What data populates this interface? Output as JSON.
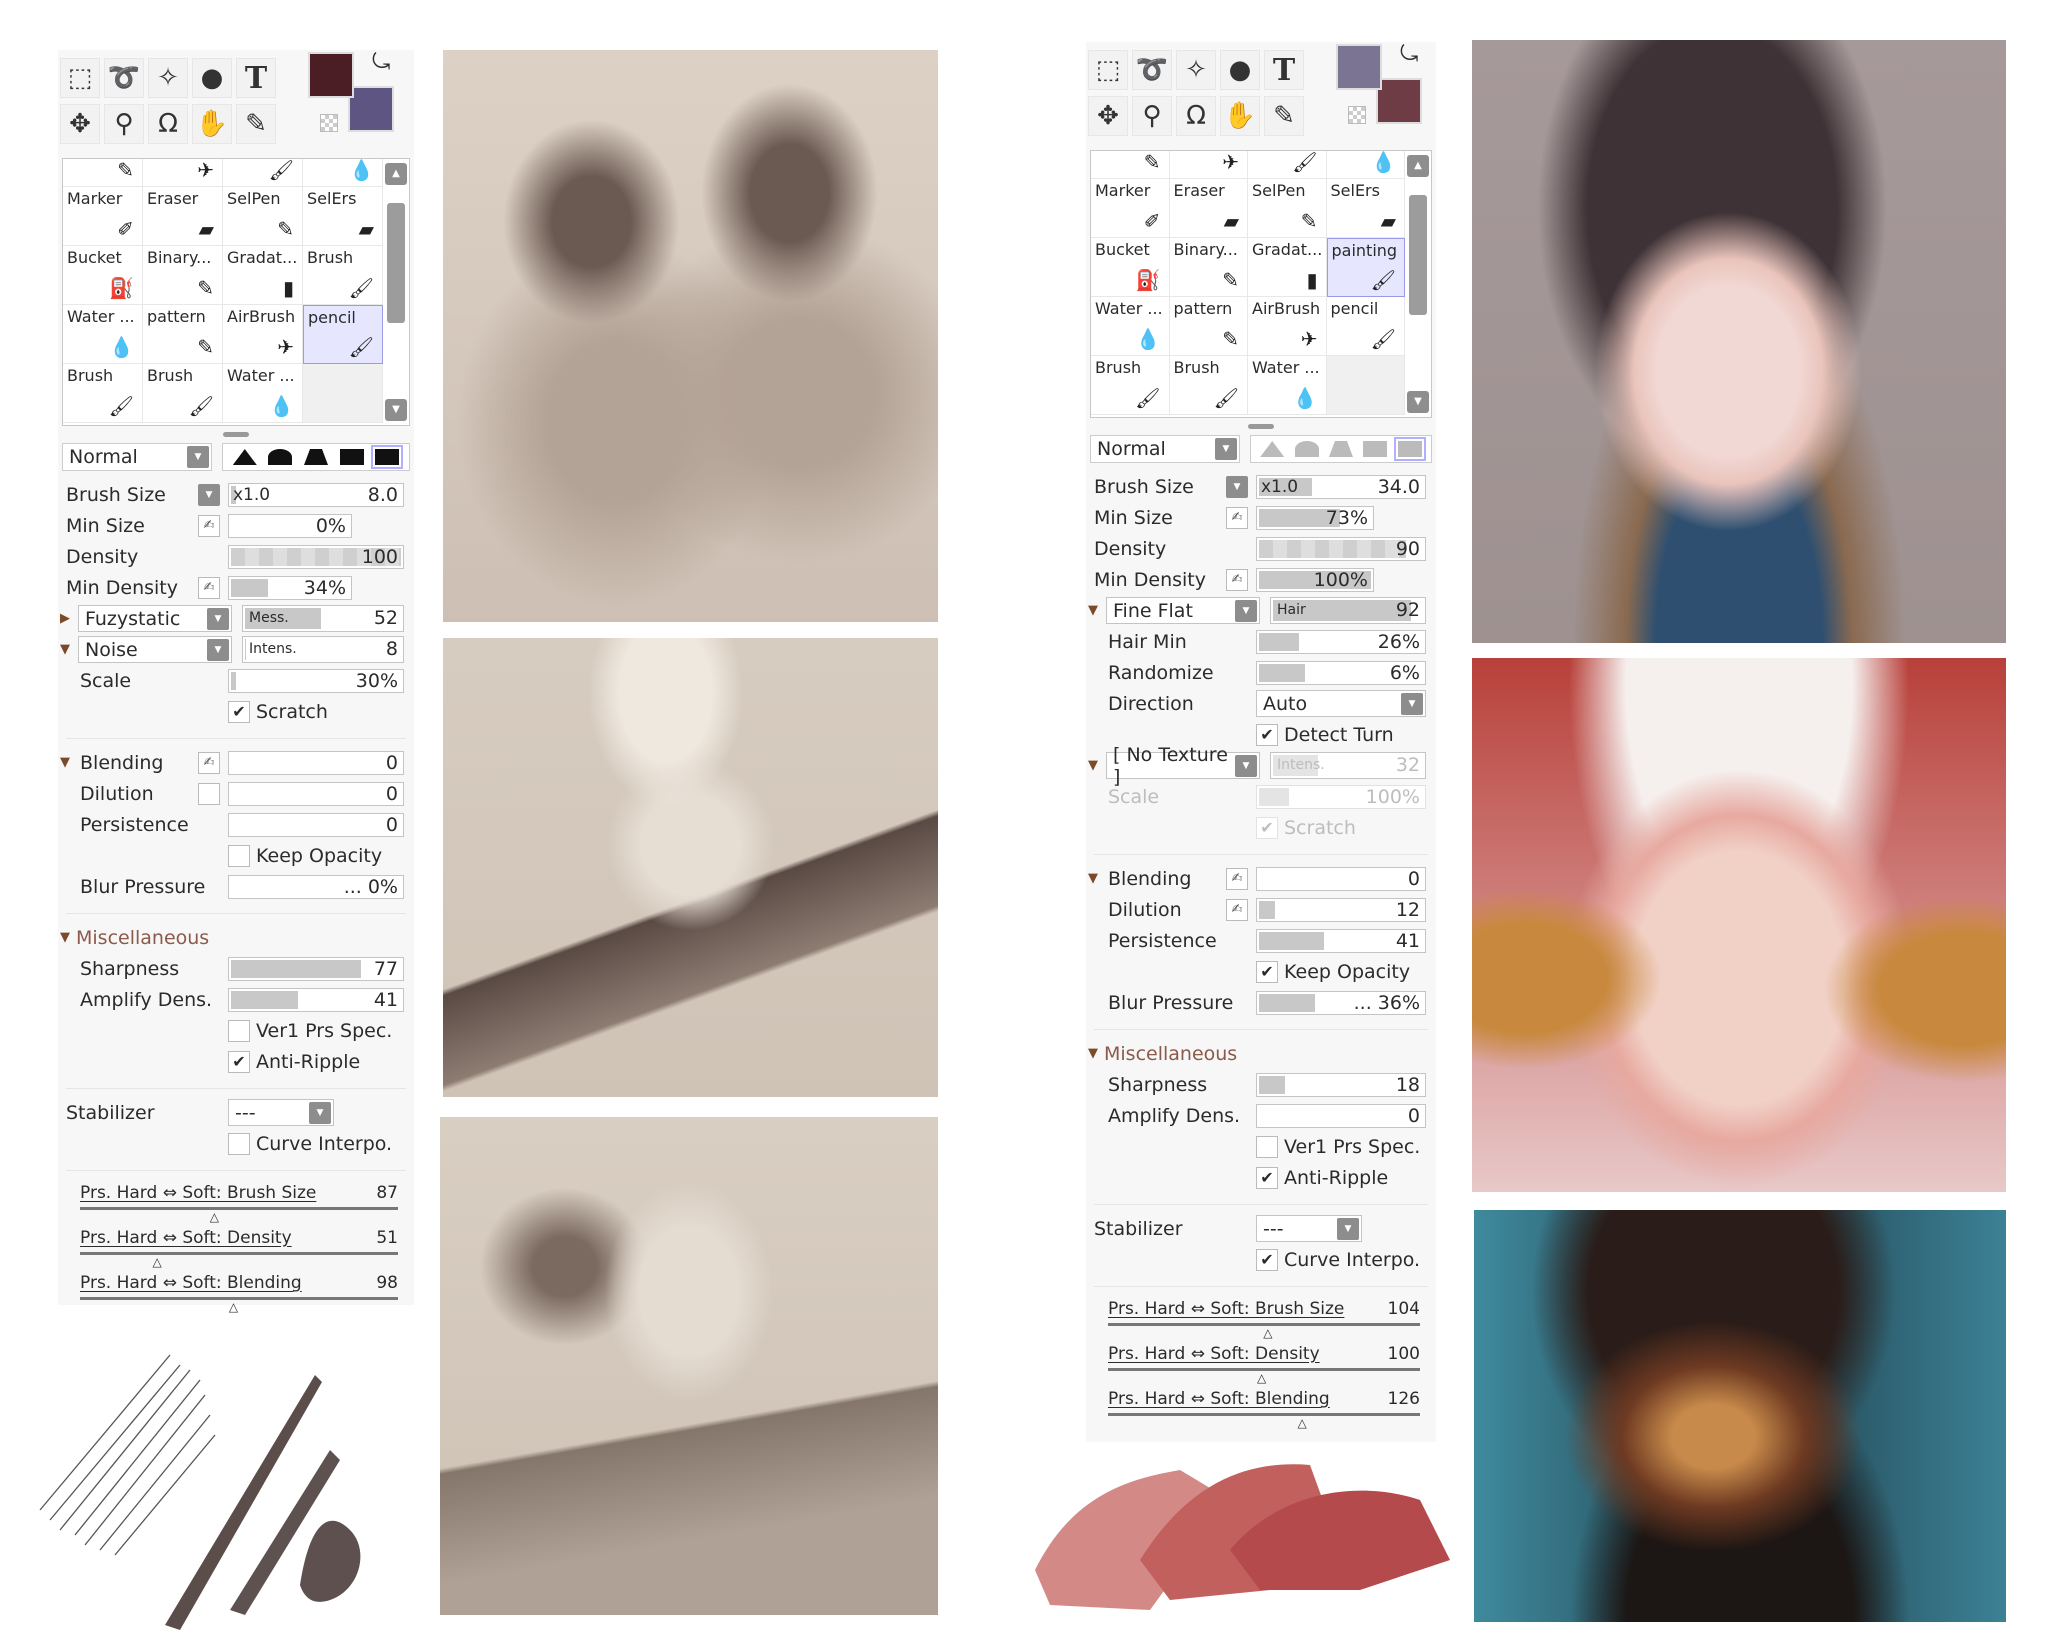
{
  "left_panel": {
    "colors": {
      "primary": "#4a1e24",
      "secondary": "#5f5582"
    },
    "tools": [
      "rect-select",
      "lasso",
      "magic-wand",
      "shapes",
      "text",
      "move",
      "zoom",
      "rotate",
      "hand",
      "eyedropper"
    ],
    "text_tool_label": "T",
    "brush_grid": [
      {
        "label": "",
        "icon": "pencil-icon"
      },
      {
        "label": "",
        "icon": "airbrush-icon"
      },
      {
        "label": "",
        "icon": "brush-icon"
      },
      {
        "label": "",
        "icon": "water-brush-icon"
      },
      {
        "label": "Marker",
        "icon": "marker-icon"
      },
      {
        "label": "Eraser",
        "icon": "eraser-icon"
      },
      {
        "label": "SelPen",
        "icon": "selpen-icon"
      },
      {
        "label": "SelErs",
        "icon": "selers-icon"
      },
      {
        "label": "Bucket",
        "icon": "bucket-icon"
      },
      {
        "label": "Binary...",
        "icon": "binary-pen-icon"
      },
      {
        "label": "Gradat...",
        "icon": "gradation-icon"
      },
      {
        "label": "Brush",
        "icon": "brush-icon"
      },
      {
        "label": "Water ...",
        "icon": "water-brush-icon"
      },
      {
        "label": "pattern",
        "icon": "pencil-icon"
      },
      {
        "label": "AirBrush",
        "icon": "airbrush-icon"
      },
      {
        "label": "pencil",
        "icon": "brush-icon",
        "selected": true
      },
      {
        "label": "Brush",
        "icon": "brush-icon"
      },
      {
        "label": "Brush",
        "icon": "brush-icon"
      },
      {
        "label": "Water ...",
        "icon": "water-brush-icon"
      },
      {
        "label": "",
        "empty": true
      }
    ],
    "blend_mode": "Normal",
    "brush_shape_selected": 5,
    "shapes_enabled": true,
    "rows": [
      {
        "type": "slider",
        "label": "Brush Size",
        "ctrl": "dropdown",
        "prefix": "x1.0",
        "value": "8.0",
        "fill": 0.05
      },
      {
        "type": "slider",
        "label": "Min Size",
        "ctrl": "pressure",
        "value": "0%",
        "fill": 0,
        "short": true
      },
      {
        "type": "slider",
        "label": "Density",
        "value": "100",
        "fill": 1,
        "checker": true
      },
      {
        "type": "slider",
        "label": "Min Density",
        "ctrl": "pressure",
        "value": "34%",
        "fill": 0.34,
        "short": true
      },
      {
        "type": "combo",
        "arrow": "right",
        "select": "Fuzystatic",
        "tag": "Mess.",
        "value": "52",
        "fill": 0.5
      },
      {
        "type": "combo",
        "arrow": "down",
        "select": "Noise",
        "tag": "Intens.",
        "value": "8",
        "fill": 0.03
      },
      {
        "type": "slider",
        "label": "Scale",
        "indent": true,
        "value": "30%",
        "fill": 0.05
      },
      {
        "type": "check",
        "label": "Scratch",
        "checked": true
      },
      {
        "type": "sep"
      },
      {
        "type": "slider",
        "label": "Blending",
        "arrow": "down",
        "indent": true,
        "ctrl": "pressure",
        "value": "0",
        "fill": 0
      },
      {
        "type": "slider",
        "label": "Dilution",
        "indent": true,
        "ctrl": "box",
        "value": "0",
        "fill": 0
      },
      {
        "type": "slider",
        "label": "Persistence",
        "indent": true,
        "value": "0",
        "fill": 0
      },
      {
        "type": "check",
        "label": "Keep Opacity",
        "checked": false
      },
      {
        "type": "slider",
        "label": "Blur Pressure",
        "indent": true,
        "value": "... 0%",
        "fill": 0
      },
      {
        "type": "sep"
      },
      {
        "type": "header",
        "label": "Miscellaneous"
      },
      {
        "type": "slider",
        "label": "Sharpness",
        "indent": true,
        "value": "77",
        "fill": 0.77
      },
      {
        "type": "slider",
        "label": "Amplify Dens.",
        "indent": true,
        "value": "41",
        "fill": 0.41
      },
      {
        "type": "check",
        "label": "Ver1 Prs Spec.",
        "checked": false
      },
      {
        "type": "check",
        "label": "Anti-Ripple",
        "checked": true
      },
      {
        "type": "sep"
      },
      {
        "type": "select",
        "label": "Stabilizer",
        "value": "---"
      },
      {
        "type": "check",
        "label": "Curve Interpo.",
        "checked": false
      },
      {
        "type": "sep"
      },
      {
        "type": "prs",
        "label": "Prs. Hard ⇔ Soft: Brush Size",
        "value": "87",
        "marker": 0.43
      },
      {
        "type": "prs",
        "label": "Prs. Hard ⇔ Soft: Density",
        "value": "51",
        "marker": 0.25
      },
      {
        "type": "prs",
        "label": "Prs. Hard ⇔ Soft: Blending",
        "value": "98",
        "marker": 0.49
      }
    ]
  },
  "right_panel": {
    "colors": {
      "primary": "#7b7493",
      "secondary": "#6e3c44"
    },
    "tools": [
      "rect-select",
      "lasso",
      "magic-wand",
      "shapes",
      "text",
      "move",
      "zoom",
      "rotate",
      "hand",
      "eyedropper"
    ],
    "text_tool_label": "T",
    "brush_grid": [
      {
        "label": "",
        "icon": "pencil-icon"
      },
      {
        "label": "",
        "icon": "airbrush-icon"
      },
      {
        "label": "",
        "icon": "brush-icon"
      },
      {
        "label": "",
        "icon": "water-brush-icon"
      },
      {
        "label": "Marker",
        "icon": "marker-icon"
      },
      {
        "label": "Eraser",
        "icon": "eraser-icon"
      },
      {
        "label": "SelPen",
        "icon": "selpen-icon"
      },
      {
        "label": "SelErs",
        "icon": "selers-icon"
      },
      {
        "label": "Bucket",
        "icon": "bucket-icon"
      },
      {
        "label": "Binary...",
        "icon": "binary-pen-icon"
      },
      {
        "label": "Gradat...",
        "icon": "gradation-icon"
      },
      {
        "label": "painting",
        "icon": "brush-icon",
        "selected": true
      },
      {
        "label": "Water ...",
        "icon": "water-brush-icon"
      },
      {
        "label": "pattern",
        "icon": "pencil-icon"
      },
      {
        "label": "AirBrush",
        "icon": "airbrush-icon"
      },
      {
        "label": "pencil",
        "icon": "brush-icon"
      },
      {
        "label": "Brush",
        "icon": "brush-icon"
      },
      {
        "label": "Brush",
        "icon": "brush-icon"
      },
      {
        "label": "Water ...",
        "icon": "water-brush-icon"
      },
      {
        "label": "",
        "empty": true
      }
    ],
    "blend_mode": "Normal",
    "brush_shape_selected": 5,
    "shapes_enabled": false,
    "rows": [
      {
        "type": "slider",
        "label": "Brush Size",
        "ctrl": "dropdown",
        "prefix": "x1.0",
        "value": "34.0",
        "fill": 0.34
      },
      {
        "type": "slider",
        "label": "Min Size",
        "ctrl": "pressure",
        "value": "73%",
        "fill": 0.73,
        "short": true
      },
      {
        "type": "slider",
        "label": "Density",
        "value": "90",
        "fill": 0.9,
        "checker": true
      },
      {
        "type": "slider",
        "label": "Min Density",
        "ctrl": "pressure",
        "value": "100%",
        "fill": 1,
        "short": true
      },
      {
        "type": "combo",
        "arrow": "down",
        "select": "Fine Flat",
        "tag": "Hair",
        "value": "92",
        "fill": 0.92
      },
      {
        "type": "slider",
        "label": "Hair Min",
        "indent": true,
        "value": "26%",
        "fill": 0.26
      },
      {
        "type": "slider",
        "label": "Randomize",
        "indent": true,
        "value": "6%",
        "fill": 0.3
      },
      {
        "type": "select",
        "label": "Direction",
        "indent": true,
        "value": "Auto",
        "wide": true
      },
      {
        "type": "check",
        "label": "Detect Turn",
        "checked": true
      },
      {
        "type": "combo",
        "arrow": "down",
        "select": "[ No Texture ]",
        "tag": "Intens.",
        "value": "32",
        "fill": 0.32,
        "disabled_slider": true
      },
      {
        "type": "slider",
        "label": "Scale",
        "indent": true,
        "value": "100%",
        "fill": 0.2,
        "disabled": true
      },
      {
        "type": "check",
        "label": "Scratch",
        "checked": true,
        "disabled": true
      },
      {
        "type": "sep"
      },
      {
        "type": "slider",
        "label": "Blending",
        "arrow": "down",
        "indent": true,
        "ctrl": "pressure",
        "value": "0",
        "fill": 0
      },
      {
        "type": "slider",
        "label": "Dilution",
        "indent": true,
        "ctrl": "pressure",
        "value": "12",
        "fill": 0.12
      },
      {
        "type": "slider",
        "label": "Persistence",
        "indent": true,
        "value": "41",
        "fill": 0.41
      },
      {
        "type": "check",
        "label": "Keep Opacity",
        "checked": true
      },
      {
        "type": "slider",
        "label": "Blur Pressure",
        "indent": true,
        "value": "... 36%",
        "fill": 0.36
      },
      {
        "type": "sep"
      },
      {
        "type": "header",
        "label": "Miscellaneous"
      },
      {
        "type": "slider",
        "label": "Sharpness",
        "indent": true,
        "value": "18",
        "fill": 0.18
      },
      {
        "type": "slider",
        "label": "Amplify Dens.",
        "indent": true,
        "value": "0",
        "fill": 0
      },
      {
        "type": "check",
        "label": "Ver1 Prs Spec.",
        "checked": false
      },
      {
        "type": "check",
        "label": "Anti-Ripple",
        "checked": true
      },
      {
        "type": "sep"
      },
      {
        "type": "select",
        "label": "Stabilizer",
        "value": "---"
      },
      {
        "type": "check",
        "label": "Curve Interpo.",
        "checked": true
      },
      {
        "type": "sep"
      },
      {
        "type": "prs",
        "label": "Prs. Hard ⇔ Soft: Brush Size",
        "value": "104",
        "marker": 0.52
      },
      {
        "type": "prs",
        "label": "Prs. Hard ⇔ Soft: Density",
        "value": "100",
        "marker": 0.5
      },
      {
        "type": "prs",
        "label": "Prs. Hard ⇔ Soft: Blending",
        "value": "126",
        "marker": 0.63
      }
    ]
  },
  "artworks": {
    "left_column": [
      "sepia-sketch-two-men",
      "sepia-sketch-top-hat",
      "sepia-sketch-crown"
    ],
    "right_column": [
      "painted-portrait-dark-hair",
      "painted-portrait-horns",
      "painted-portrait-teal"
    ]
  }
}
